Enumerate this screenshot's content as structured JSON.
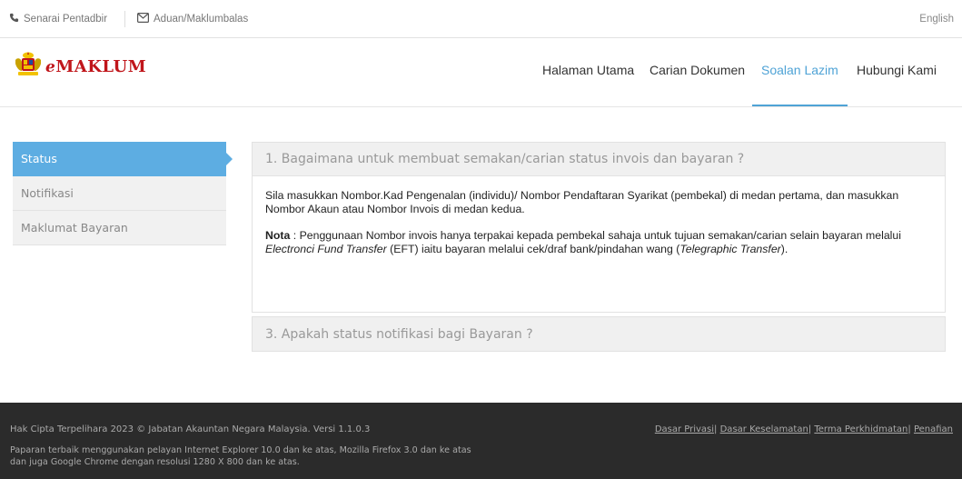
{
  "topbar": {
    "admin_label": "Senarai Pentadbir",
    "feedback_label": "Aduan/Maklumbalas",
    "language": "English"
  },
  "header": {
    "brand": "MAKLUM",
    "brand_prefix": "e",
    "nav": [
      {
        "label": "Halaman Utama"
      },
      {
        "label": "Carian Dokumen"
      },
      {
        "label": "Soalan Lazim"
      },
      {
        "label": "Hubungi Kami"
      }
    ],
    "active_nav": "Soalan Lazim"
  },
  "sidebar": {
    "items": [
      {
        "label": "Status"
      },
      {
        "label": "Notifikasi"
      },
      {
        "label": "Maklumat Bayaran"
      }
    ]
  },
  "faq": {
    "q1": "1. Bagaimana untuk membuat semakan/carian status invois dan bayaran ?",
    "a1_p1": "Sila masukkan Nombor.Kad Pengenalan (individu)/ Nombor Pendaftaran Syarikat (pembekal) di medan pertama, dan masukkan Nombor Akaun atau Nombor Invois di medan kedua.",
    "a1_nota_label": "Nota",
    "a1_p2_a": " : Penggunaan Nombor invois hanya terpakai kepada pembekal sahaja untuk tujuan semakan/carian selain bayaran melalui ",
    "a1_p2_eft": "Electronci Fund Transfer",
    "a1_p2_b": " (EFT) iaitu bayaran melalui cek/draf bank/pindahan wang (",
    "a1_p2_tt": "Telegraphic Transfer",
    "a1_p2_c": ").",
    "q3": "3. Apakah status notifikasi bagi Bayaran ?"
  },
  "footer": {
    "copyright": "Hak Cipta Terpelihara 2023 © Jabatan Akauntan Negara Malaysia. Versi 1.1.0.3",
    "best_view": "Paparan terbaik menggunakan pelayan Internet Explorer 10.0 dan ke atas, Mozilla Firefox 3.0 dan ke atas dan juga Google Chrome dengan resolusi 1280 X 800 dan ke atas.",
    "links": [
      {
        "label": "Dasar Privasi"
      },
      {
        "label": "Dasar Keselamatan"
      },
      {
        "label": "Terma Perkhidmatan"
      },
      {
        "label": "Penafian"
      }
    ]
  },
  "colors": {
    "accent": "#5dade2",
    "brand_red": "#c0161b",
    "footer_bg": "#2b2b2b"
  },
  "icons": [
    "phone-icon",
    "mail-icon",
    "crest-logo"
  ]
}
